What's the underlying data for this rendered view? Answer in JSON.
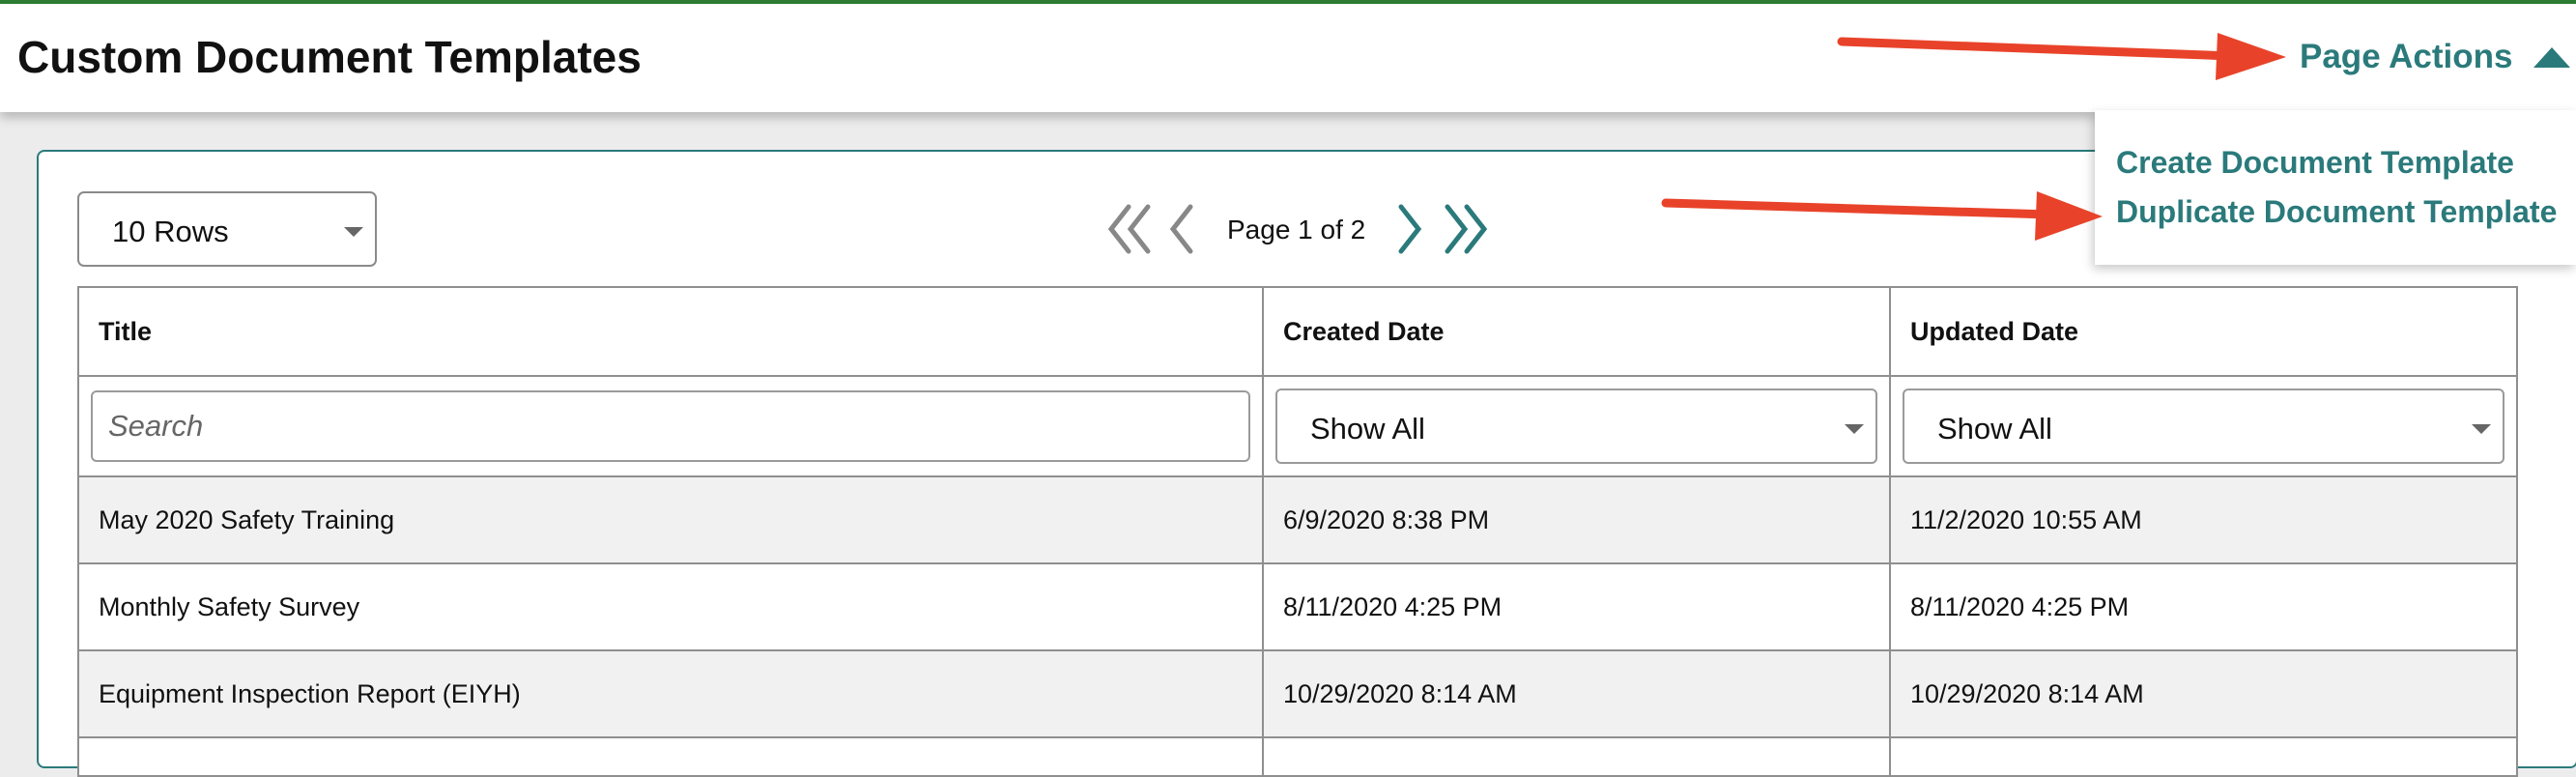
{
  "header": {
    "title": "Custom Document Templates",
    "page_actions_label": "Page Actions"
  },
  "page_actions_menu": {
    "items": [
      {
        "label": "Create Document Template"
      },
      {
        "label": "Duplicate Document Template"
      }
    ]
  },
  "toolbar": {
    "rows_select": "10 Rows",
    "pager_label": "Page 1 of 2"
  },
  "table": {
    "columns": [
      "Title",
      "Created Date",
      "Updated Date"
    ],
    "filters": {
      "title_placeholder": "Search",
      "created_date": "Show All",
      "updated_date": "Show All"
    },
    "rows": [
      {
        "title": "May 2020 Safety Training",
        "created": "6/9/2020 8:38 PM",
        "updated": "11/2/2020 10:55 AM"
      },
      {
        "title": "Monthly Safety Survey",
        "created": "8/11/2020 4:25 PM",
        "updated": "8/11/2020 4:25 PM"
      },
      {
        "title": "Equipment Inspection Report (EIYH)",
        "created": "10/29/2020 8:14 AM",
        "updated": "10/29/2020 8:14 AM"
      }
    ]
  },
  "colors": {
    "accent": "#2b7a7b",
    "top_border": "#2e7d32",
    "annotation_arrow": "#e8432a",
    "row_shade": "#f1f1f1"
  },
  "icons": {
    "pager": [
      "first-page-icon",
      "previous-page-icon",
      "next-page-icon",
      "last-page-icon"
    ],
    "page_actions": "caret-up-icon",
    "annotations": "red-arrow"
  }
}
